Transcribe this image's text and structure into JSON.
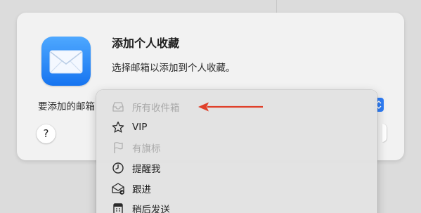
{
  "dialog": {
    "title": "添加个人收藏",
    "subtitle": "选择邮箱以添加到个人收藏。",
    "mailbox_label": "要添加的邮箱",
    "help_label": "?"
  },
  "menu": {
    "items": [
      {
        "label": "所有收件箱",
        "icon": "inbox-tray-icon",
        "enabled": false
      },
      {
        "label": "VIP",
        "icon": "star-icon",
        "enabled": true
      },
      {
        "label": "有旗标",
        "icon": "flag-icon",
        "enabled": false
      },
      {
        "label": "提醒我",
        "icon": "clock-icon",
        "enabled": true
      },
      {
        "label": "跟进",
        "icon": "follow-up-envelope-icon",
        "enabled": true
      },
      {
        "label": "稍后发送",
        "icon": "send-later-icon",
        "enabled": true
      }
    ]
  },
  "colors": {
    "accent": "#2f7df6",
    "annotation_arrow": "#e0402a"
  }
}
